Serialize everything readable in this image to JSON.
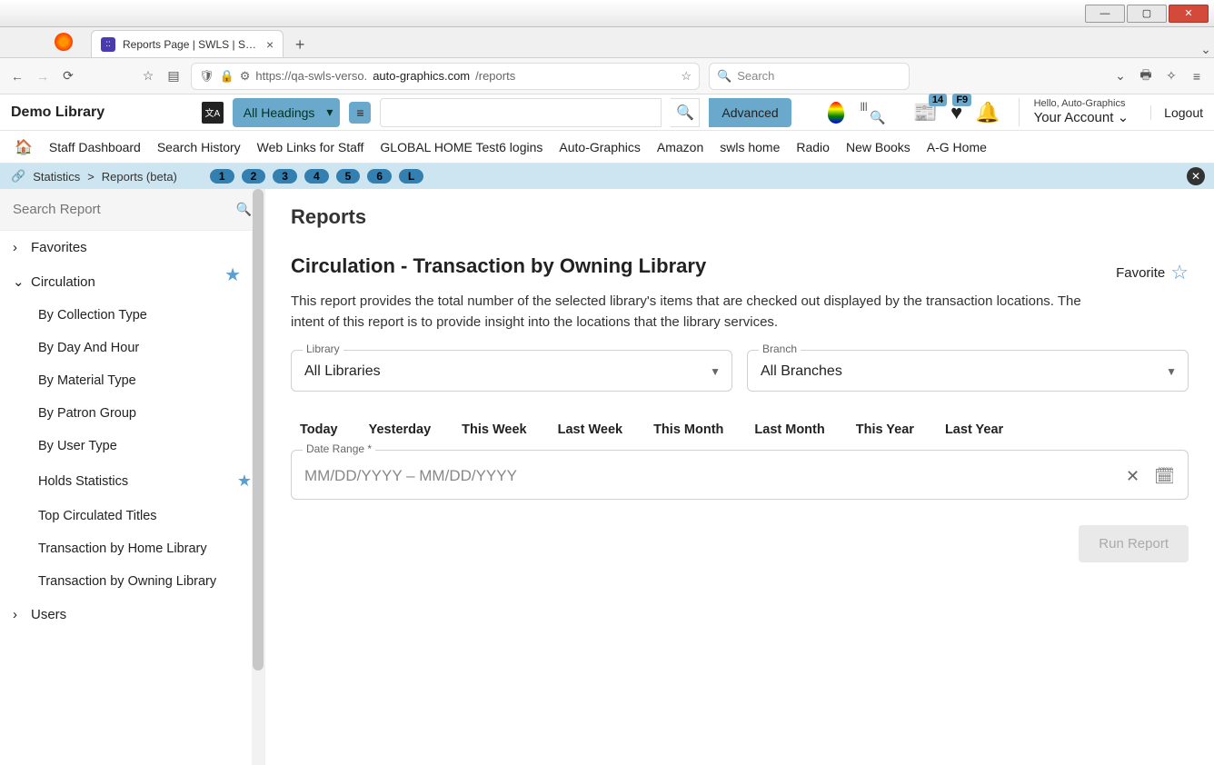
{
  "browser": {
    "tab_title": "Reports Page | SWLS | SWLS | A…",
    "url_prefix": "https://qa-swls-verso.",
    "url_domain": "auto-graphics.com",
    "url_path": "/reports",
    "search_placeholder": "Search"
  },
  "header": {
    "site_title": "Demo Library",
    "headings_label": "All Headings",
    "advanced_label": "Advanced",
    "hello_text": "Hello, Auto-Graphics",
    "account_label": "Your Account",
    "logout_label": "Logout",
    "badge_news": "14",
    "badge_fav": "F9"
  },
  "nav": {
    "items": [
      "Staff Dashboard",
      "Search History",
      "Web Links for Staff",
      "GLOBAL HOME Test6 logins",
      "Auto-Graphics",
      "Amazon",
      "swls home",
      "Radio",
      "New Books",
      "A-G Home"
    ]
  },
  "crumb": {
    "path1": "Statistics",
    "path2": "Reports (beta)",
    "pills": [
      "1",
      "2",
      "3",
      "4",
      "5",
      "6",
      "L"
    ]
  },
  "sidebar": {
    "search_placeholder": "Search Report",
    "favorites": "Favorites",
    "circulation": "Circulation",
    "items": [
      "By Collection Type",
      "By Day And Hour",
      "By Material Type",
      "By Patron Group",
      "By User Type",
      "Holds Statistics",
      "Top Circulated Titles",
      "Transaction by Home Library",
      "Transaction by Owning Library"
    ],
    "users": "Users"
  },
  "content": {
    "page_title": "Reports",
    "report_title": "Circulation - Transaction by Owning Library",
    "favorite_label": "Favorite",
    "description": "This report provides the total number of the selected library's items that are checked out displayed by the transaction locations. The intent of this report is to provide insight into the locations that the library services.",
    "library_label": "Library",
    "library_value": "All Libraries",
    "branch_label": "Branch",
    "branch_value": "All Branches",
    "date_chips": [
      "Today",
      "Yesterday",
      "This Week",
      "Last Week",
      "This Month",
      "Last Month",
      "This Year",
      "Last Year"
    ],
    "date_range_label": "Date Range *",
    "date_range_placeholder": "MM/DD/YYYY – MM/DD/YYYY",
    "run_label": "Run Report"
  }
}
